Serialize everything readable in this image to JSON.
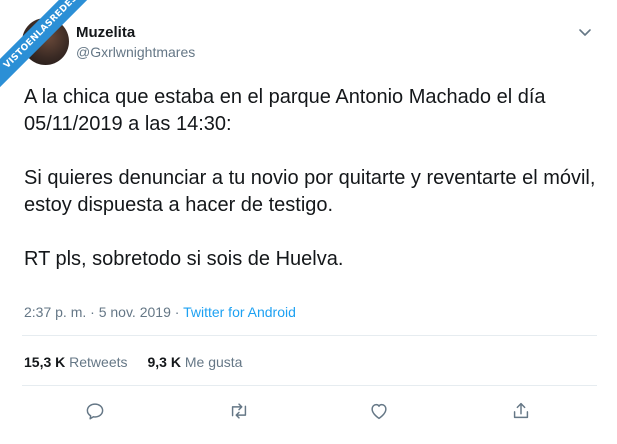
{
  "watermark": {
    "text": "VISTOENLASREDES"
  },
  "user": {
    "display_name": "Muzelita",
    "handle": "@Gxrlwnightmares"
  },
  "tweet": {
    "paragraphs": [
      "A la chica que estaba en el parque Antonio Machado el día 05/11/2019 a las 14:30:",
      "Si quieres denunciar a tu novio por quitarte y reventarte el móvil, estoy dispuesta a hacer de testigo.",
      "RT pls, sobretodo si sois de Huelva."
    ],
    "time": "2:37 p. m.",
    "separator1": " · ",
    "date": "5 nov. 2019",
    "separator2": " · ",
    "source": "Twitter for Android"
  },
  "stats": {
    "retweets_count": "15,3 K",
    "retweets_label": "Retweets",
    "likes_count": "9,3 K",
    "likes_label": "Me gusta"
  },
  "icons": {
    "menu": "chevron-down-icon",
    "reply": "reply-icon",
    "retweet": "retweet-icon",
    "like": "heart-icon",
    "share": "share-icon"
  },
  "colors": {
    "link": "#1da1f2",
    "secondary": "#657786",
    "ribbon": "#2b8fd6"
  }
}
